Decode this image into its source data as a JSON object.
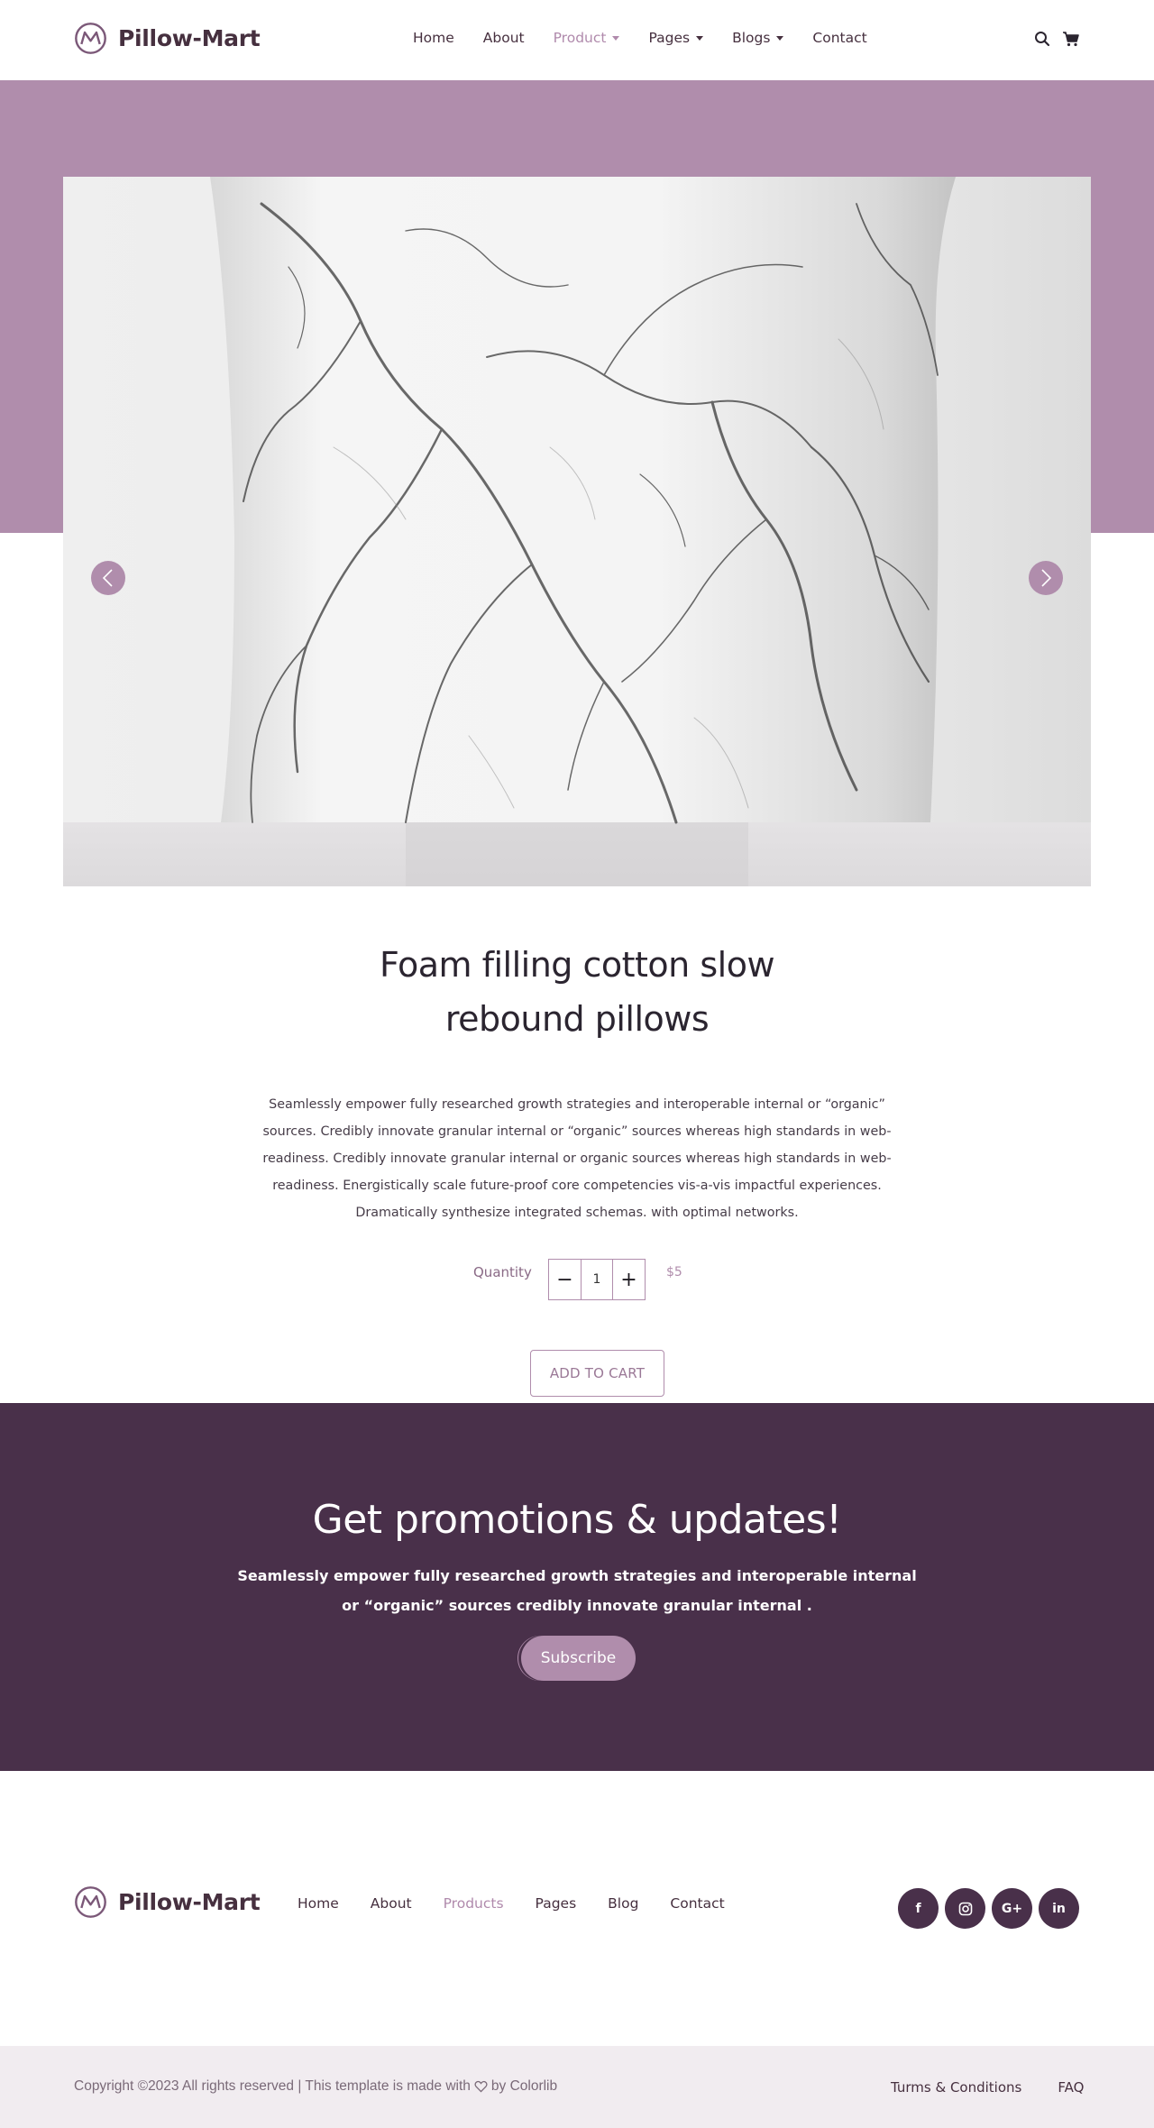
{
  "brand": {
    "name": "Pillow-Mart"
  },
  "nav": {
    "items": [
      {
        "label": "Home",
        "dropdown": false,
        "active": false
      },
      {
        "label": "About",
        "dropdown": false,
        "active": false
      },
      {
        "label": "Product",
        "dropdown": true,
        "active": true
      },
      {
        "label": "Pages",
        "dropdown": true,
        "active": false
      },
      {
        "label": "Blogs",
        "dropdown": true,
        "active": false
      },
      {
        "label": "Contact",
        "dropdown": false,
        "active": false
      }
    ],
    "icons": [
      "search-icon",
      "cart-icon"
    ]
  },
  "hero": {
    "image": "marble-pillow",
    "prev_icon": "chevron-left-icon",
    "next_icon": "chevron-right-icon"
  },
  "product": {
    "title": "Foam filling cotton slow rebound pillows",
    "description": "Seamlessly empower fully researched growth strategies and interoperable internal or “organic” sources. Credibly innovate granular internal or “organic” sources whereas high standards in web-readiness. Credibly innovate granular internal or organic sources whereas high standards in web-readiness. Energistically scale future-proof core competencies vis-a-vis impactful experiences. Dramatically synthesize integrated schemas. with optimal networks.",
    "quantity_label": "Quantity",
    "quantity_value": "1",
    "decrement": "−",
    "increment": "+",
    "price": "$5",
    "add_to_cart": "ADD TO CART"
  },
  "promo": {
    "title": "Get promotions & updates!",
    "text": "Seamlessly empower fully researched growth strategies and interoperable internal or “organic” sources credibly innovate granular internal .",
    "subscribe": "Subscribe"
  },
  "footer": {
    "brand": "Pillow-Mart",
    "nav": [
      {
        "label": "Home",
        "active": false
      },
      {
        "label": "About",
        "active": false
      },
      {
        "label": "Products",
        "active": true
      },
      {
        "label": "Pages",
        "active": false
      },
      {
        "label": "Blog",
        "active": false
      },
      {
        "label": "Contact",
        "active": false
      }
    ],
    "social": [
      {
        "icon": "facebook-icon",
        "glyph": "f"
      },
      {
        "icon": "instagram-icon",
        "glyph": ""
      },
      {
        "icon": "google-plus-icon",
        "glyph": "G+"
      },
      {
        "icon": "linkedin-icon",
        "glyph": "in"
      }
    ],
    "copyright_prefix": "Copyright ©2023 All rights reserved | This template is made with",
    "copyright_suffix": "by Colorlib",
    "legal": [
      "Turms & Conditions",
      "FAQ"
    ]
  },
  "colors": {
    "accent": "#b08dac",
    "dark": "#49304a",
    "text": "#46303f",
    "bottom_bar": "#f1ecf0"
  }
}
